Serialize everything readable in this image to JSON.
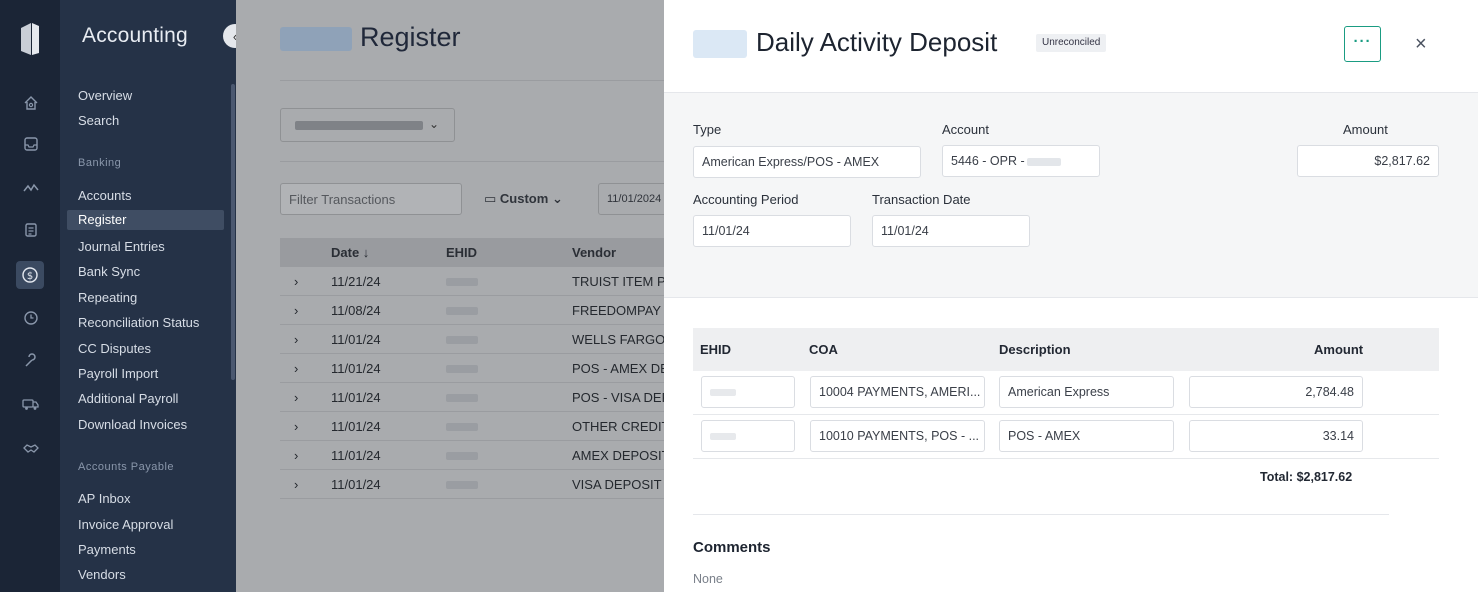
{
  "rail": {
    "icons": [
      "logo-icon",
      "home-icon",
      "inbox-icon",
      "activity-icon",
      "document-icon",
      "dollar-icon",
      "clock-icon",
      "wrench-icon",
      "truck-icon",
      "handshake-icon"
    ]
  },
  "nav": {
    "brand": "Accounting",
    "collapse_glyph": "‹",
    "items_top": [
      "Overview",
      "Search"
    ],
    "section_banking": "Banking",
    "items_banking": [
      "Accounts",
      "Register",
      "Journal Entries",
      "Bank Sync",
      "Repeating",
      "Reconciliation Status",
      "CC Disputes",
      "Payroll Import",
      "Additional Payroll",
      "Download Invoices"
    ],
    "section_ap": "Accounts Payable",
    "items_ap": [
      "AP Inbox",
      "Invoice Approval",
      "Payments",
      "Vendors"
    ],
    "active": "Register"
  },
  "main": {
    "title": "Register",
    "filter_placeholder": "Filter Transactions",
    "custom_label": "Custom",
    "date_from": "11/01/2024",
    "columns": {
      "date": "Date ↓",
      "ehid": "EHID",
      "vendor": "Vendor"
    },
    "rows": [
      {
        "date": "11/21/24",
        "vendor": "TRUIST ITEM PR"
      },
      {
        "date": "11/08/24",
        "vendor": "FREEDOMPAY"
      },
      {
        "date": "11/01/24",
        "vendor": "WELLS FARGO V"
      },
      {
        "date": "11/01/24",
        "vendor": "POS - AMEX DEI"
      },
      {
        "date": "11/01/24",
        "vendor": "POS - VISA DEPO"
      },
      {
        "date": "11/01/24",
        "vendor": "OTHER CREDIT C"
      },
      {
        "date": "11/01/24",
        "vendor": "AMEX DEPOSIT"
      },
      {
        "date": "11/01/24",
        "vendor": "VISA DEPOSIT"
      }
    ]
  },
  "drawer": {
    "title": "Daily Activity Deposit",
    "status": "Unreconciled",
    "more_glyph": "···",
    "close_glyph": "×",
    "type_label": "Type",
    "type_value": "American Express/POS - AMEX",
    "account_label": "Account",
    "account_value": "5446 - OPR -",
    "amount_label": "Amount",
    "amount_value": "$2,817.62",
    "period_label": "Accounting Period",
    "period_value": "11/01/24",
    "txdate_label": "Transaction Date",
    "txdate_value": "11/01/24",
    "lines_headers": {
      "ehid": "EHID",
      "coa": "COA",
      "description": "Description",
      "amount": "Amount"
    },
    "lines": [
      {
        "coa": "10004 PAYMENTS, AMERI...",
        "description": "American Express",
        "amount": "2,784.48"
      },
      {
        "coa": "10010 PAYMENTS, POS - ...",
        "description": "POS - AMEX",
        "amount": "33.14"
      }
    ],
    "total": "Total: $2,817.62",
    "comments_title": "Comments",
    "comments_value": "None"
  }
}
